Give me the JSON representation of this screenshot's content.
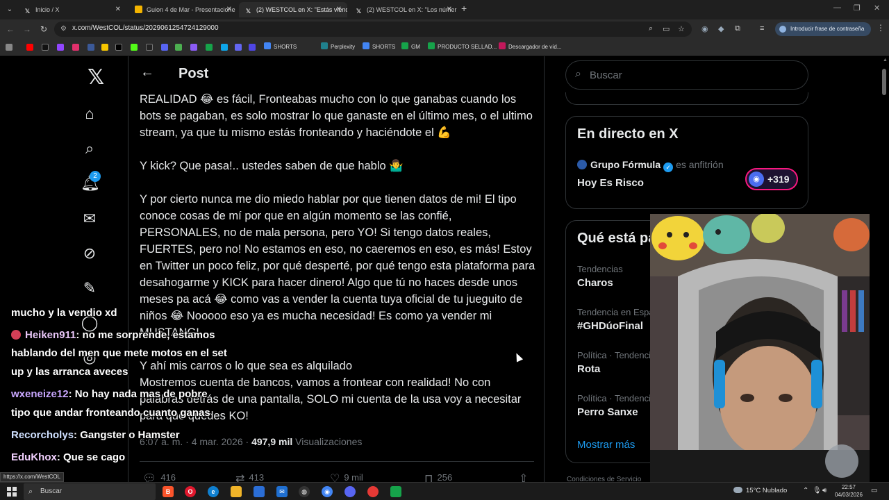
{
  "browser": {
    "tabs": [
      {
        "title": "Inicio / X",
        "favicon": "x-icon"
      },
      {
        "title": "Guion 4 de Mar - Presentacione",
        "favicon": "slides-icon"
      },
      {
        "title": "(2) WESTCOL en X: \"Estás viend",
        "favicon": "x-icon"
      },
      {
        "title": "(2) WESTCOL en X: \"Los númer",
        "favicon": "x-icon"
      }
    ],
    "url": "x.com/WestCOL/status/2029061254724129000",
    "password_button": "Introducir frase de contraseña",
    "bookmarks": [
      "SHORTS",
      "Perplexity",
      "SHORTS",
      "GM",
      "PRODUCTO SELLAD...",
      "Descargador de víd..."
    ]
  },
  "nav": {
    "notifications_count": "2"
  },
  "post": {
    "header_title": "Post",
    "paragraphs": [
      "REALIDAD 😂 es fácil, Fronteabas mucho con lo que ganabas cuando los bots se pagaban, es solo mostrar lo que ganaste en el último mes, o el ultimo stream, ya que tu mismo estás fronteando y haciéndote el 💪",
      "Y kick? Que pasa!.. ustedes saben de que hablo 🤷‍♂️",
      "Y por cierto nunca me dio miedo hablar por que tienen datos de mi! El tipo conoce cosas de mí por que en algún momento se las confié, PERSONALES, no de mala persona, pero YO! Si tengo datos reales, FUERTES, pero no! No estamos en eso, no caeremos en eso, es más! Estoy en Twitter un poco feliz, por qué desperté, por qué tengo esta plataforma para desahogarme y KICK para hacer dinero! Algo que tú no haces desde unos meses pa acá 😂 como vas a vender la cuenta tuya oficial de tu jueguito de niños 😂 Nooooo eso ya es mucha necesidad! Es como ya vender mi MUSTANG!",
      "Y ahí mis carros o lo que sea es alquilado\nMostremos cuenta de bancos, vamos a frontear con realidad! No con palabras detrás de una pantalla, SOLO mi cuenta de la usa voy a necesitar para que quedes KO!"
    ],
    "time": "6:07 a. m. · 4 mar. 2026 · ",
    "views_count": "497,9 mil",
    "views_label": " Visualizaciones",
    "actions": {
      "replies": "416",
      "reposts": "413",
      "likes": "9 mil",
      "bookmarks": "256"
    }
  },
  "sidebar": {
    "search_placeholder": "Buscar",
    "live": {
      "title": "En directo en X",
      "host": "Grupo Fórmula",
      "host_role": "es anfitrión",
      "space_title": "Hoy Es Risco",
      "listeners": "+319"
    },
    "trends": {
      "title": "Qué está pasando",
      "items": [
        {
          "category": "Tendencias",
          "name": "Charos"
        },
        {
          "category": "Tendencia en España",
          "name": "#GHDúoFinal"
        },
        {
          "category": "Política · Tendencia",
          "name": "Rota"
        },
        {
          "category": "Política · Tendencia",
          "name": "Perro Sanxe"
        }
      ],
      "show_more": "Mostrar más"
    },
    "footer": "Condiciones de Servicio"
  },
  "chat": [
    {
      "user": "",
      "message": "mucho y la vendio xd"
    },
    {
      "user": "Heiken911",
      "message": ": no me sorprende, estamos"
    },
    {
      "user": "",
      "message": "hablando del men que mete motos en el set"
    },
    {
      "user": "",
      "message": "up y las arranca aveces"
    },
    {
      "user": "wxeneize12",
      "message": ": No hay nada mas de pobre"
    },
    {
      "user": "",
      "message": "tipo que andar fronteando cuanto ganas"
    },
    {
      "user": "Recorcholys",
      "message": ": Gangster o Hamster"
    },
    {
      "user": "EduKhox",
      "message": ": Que se cago"
    }
  ],
  "status_url": "https://x.com/WestCOL",
  "taskbar": {
    "search_label": "Buscar",
    "weather": "15°C  Nublado",
    "time": "22:57",
    "date": "04/03/2026"
  },
  "colors": {
    "accent": "#1d9bf0",
    "background": "#000000",
    "text": "#e7e9ea",
    "muted": "#71767b",
    "border": "#2f3336",
    "live_ring": "#f91880"
  }
}
